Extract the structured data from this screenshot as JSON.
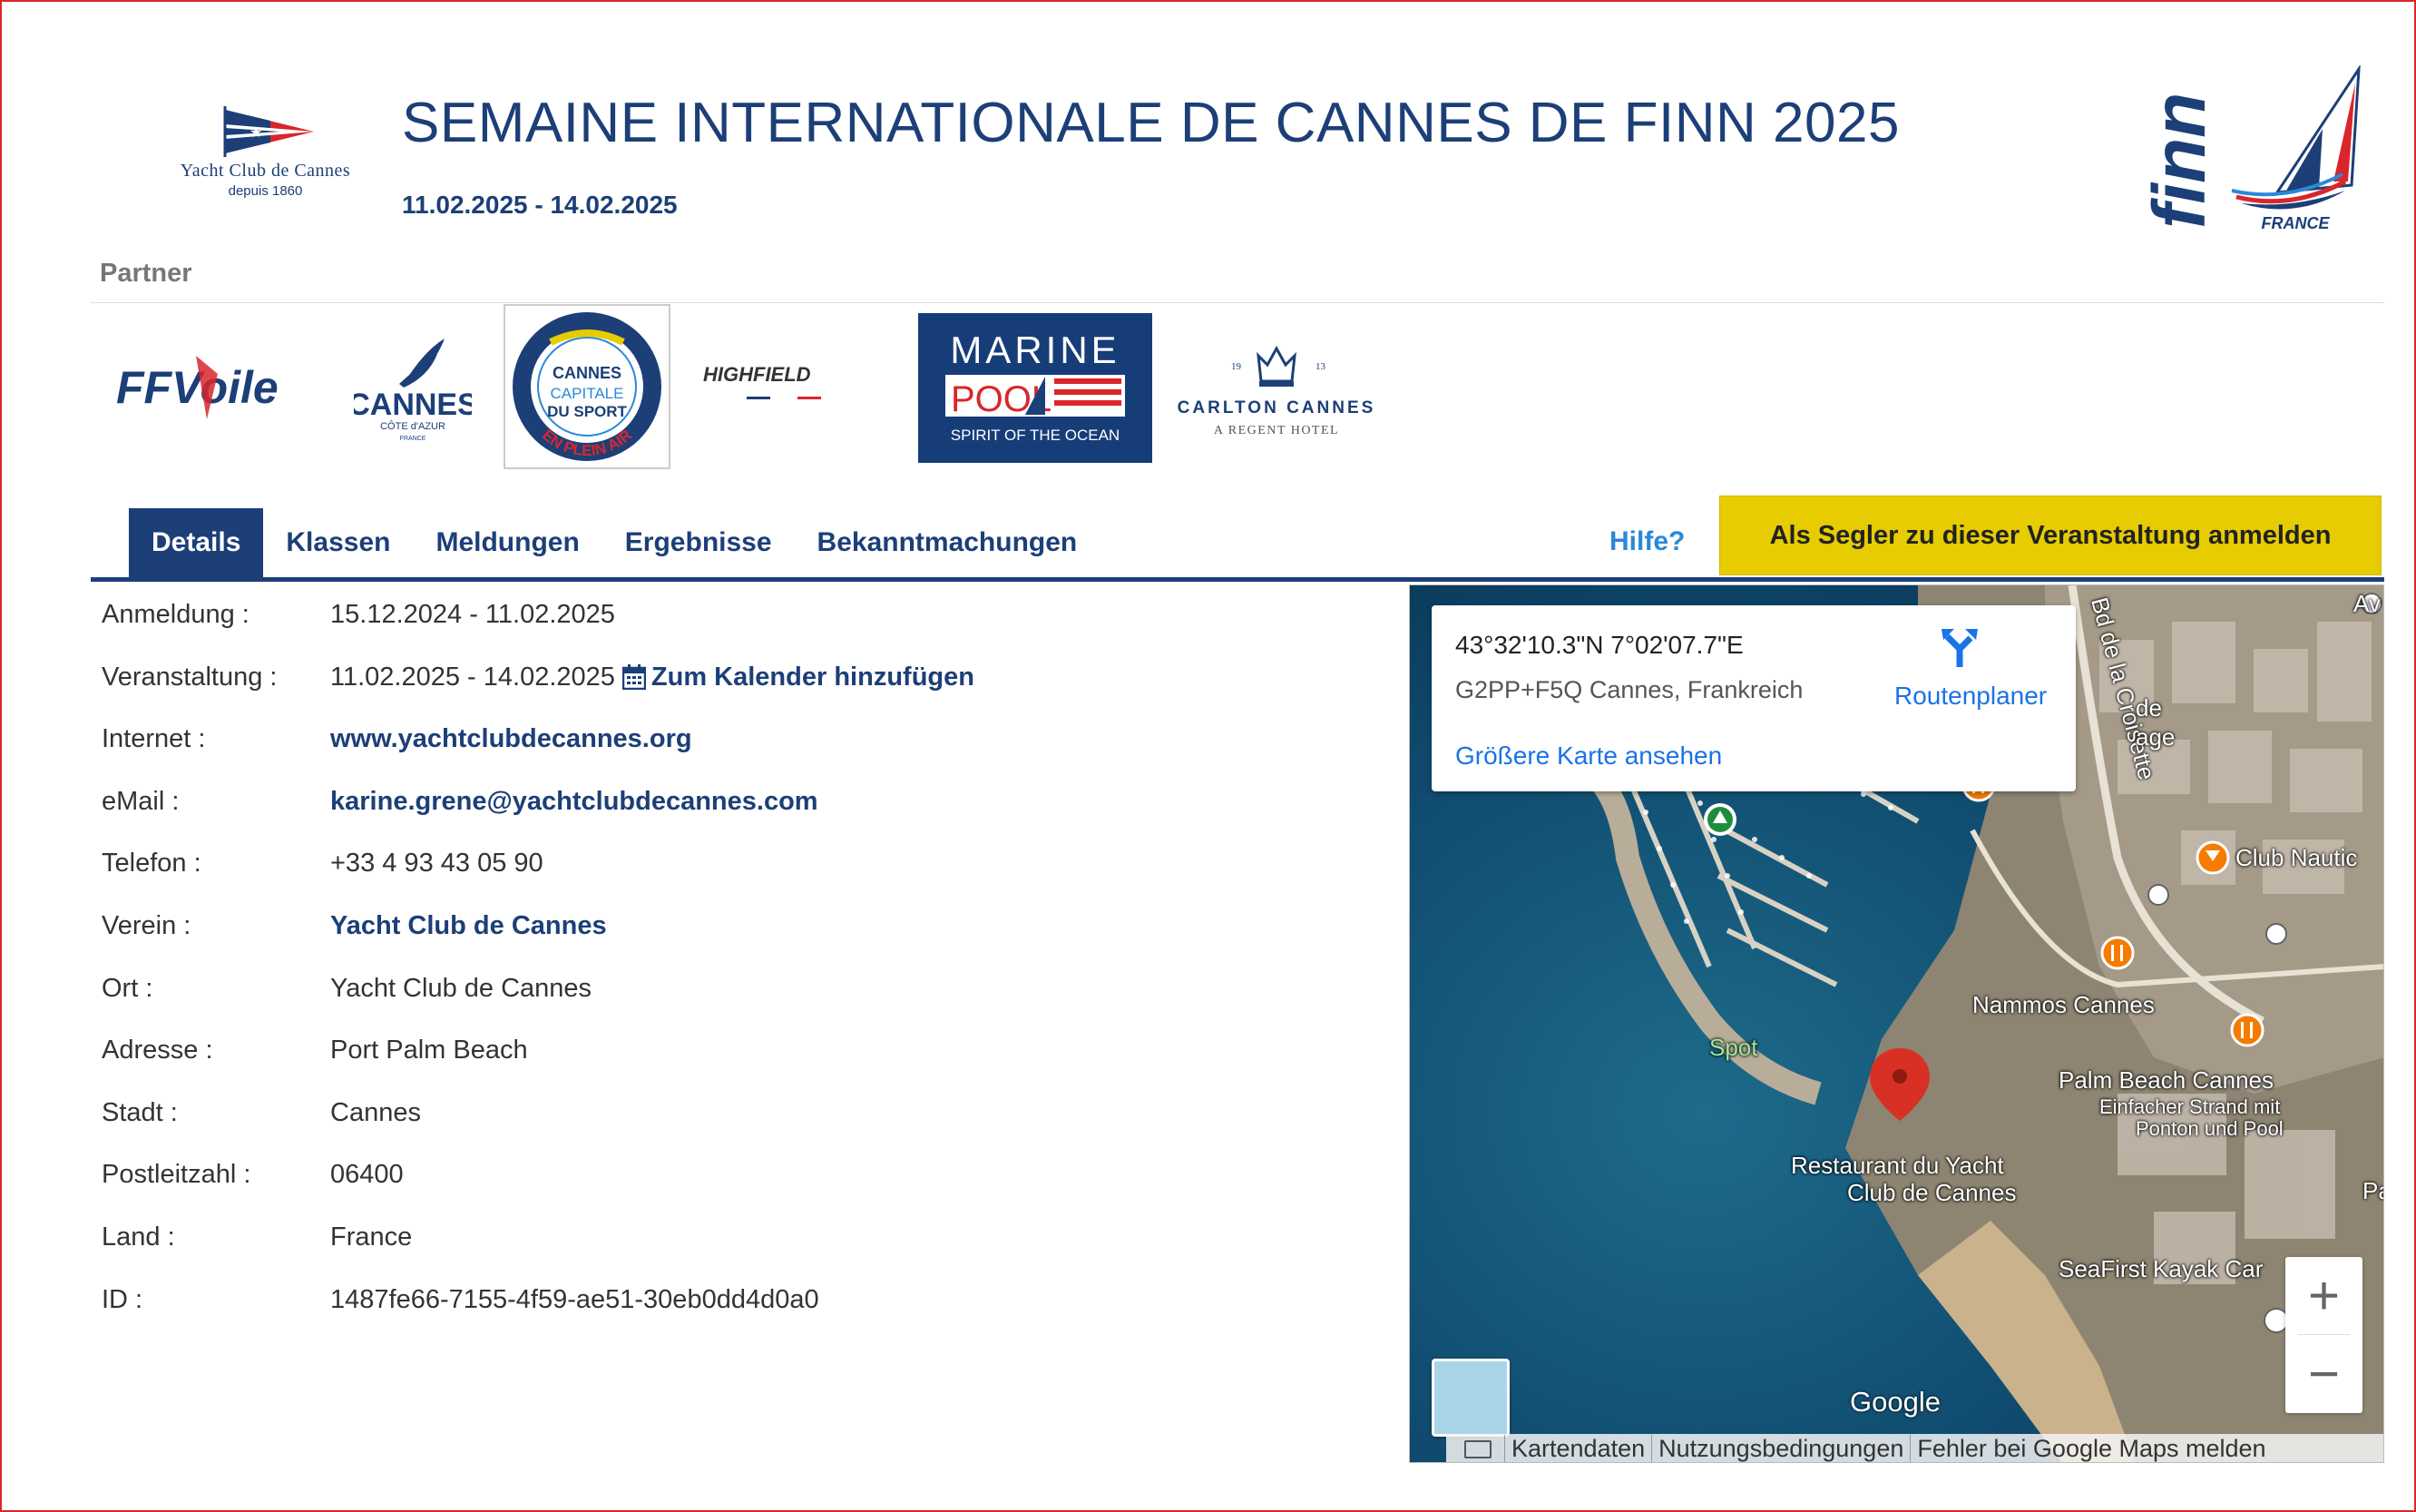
{
  "header": {
    "club_name": "Yacht Club de Cannes",
    "club_since": "depuis 1860",
    "title": "SEMAINE INTERNATIONALE DE CANNES DE FINN 2025",
    "dates": "11.02.2025 - 14.02.2025",
    "class_logo_word": "finn",
    "class_logo_country": "FRANCE"
  },
  "partners": {
    "label": "Partner",
    "logos": {
      "ffvoile": "FFVoile",
      "cannes": "CANNES",
      "cannes_sub": "CÔTE d'AZUR",
      "cannes_country": "FRANCE",
      "capitale_top": "CANNES",
      "capitale_mid1": "CAPITALE",
      "capitale_mid2": "DU SPORT",
      "capitale_arc": "EN PLEIN AIR",
      "highfield": "HIGHFIELD",
      "marine_top": "MARINE",
      "marine_mid": "POOL",
      "marine_bottom": "SPIRIT OF THE OCEAN",
      "carlton_year_left": "19",
      "carlton_year_right": "13",
      "carlton_name": "CARLTON CANNES",
      "carlton_sub": "A REGENT HOTEL"
    }
  },
  "tabs": [
    {
      "label": "Details",
      "active": true
    },
    {
      "label": "Klassen",
      "active": false
    },
    {
      "label": "Meldungen",
      "active": false
    },
    {
      "label": "Ergebnisse",
      "active": false
    },
    {
      "label": "Bekanntmachungen",
      "active": false
    }
  ],
  "help_label": "Hilfe?",
  "register_label": "Als Segler zu dieser Veranstaltung anmelden",
  "details": [
    {
      "label": "Anmeldung :",
      "value": "15.12.2024 - 11.02.2025",
      "link": false
    },
    {
      "label": "Veranstaltung :",
      "value": "11.02.2025 - 14.02.2025",
      "link": false,
      "calendar": "Zum Kalender hinzufügen"
    },
    {
      "label": "Internet :",
      "value": "www.yachtclubdecannes.org",
      "link": true
    },
    {
      "label": "eMail :",
      "value": "karine.grene@yachtclubdecannes.com",
      "link": true
    },
    {
      "label": "Telefon :",
      "value": "+33 4 93 43 05 90",
      "link": false
    },
    {
      "label": "Verein :",
      "value": "Yacht Club de Cannes",
      "link": true
    },
    {
      "label": "Ort :",
      "value": "Yacht Club de Cannes",
      "link": false
    },
    {
      "label": "Adresse :",
      "value": "Port Palm Beach",
      "link": false
    },
    {
      "label": "Stadt :",
      "value": "Cannes",
      "link": false
    },
    {
      "label": "Postleitzahl :",
      "value": "06400",
      "link": false
    },
    {
      "label": "Land :",
      "value": "France",
      "link": false
    },
    {
      "label": "ID :",
      "value": "1487fe66-7155-4f59-ae51-30eb0dd4d0a0",
      "link": false
    }
  ],
  "map": {
    "coords": "43°32'10.3\"N 7°02'07.7\"E",
    "plus_code": "G2PP+F5Q Cannes, Frankreich",
    "route_label": "Routenplaner",
    "bigger_map": "Größere Karte ansehen",
    "labels": {
      "croisette": "Bd de la Croisette",
      "club_nautic": "Club Nautic",
      "nammos": "Nammos Cannes",
      "palm_beach": "Palm Beach Cannes",
      "palm_beach_sub1": "Einfacher Strand mit",
      "palm_beach_sub2": "Ponton und Pool",
      "spot": "Spot",
      "restaurant1": "Restaurant du Yacht",
      "restaurant2": "Club de Cannes",
      "seafirst": "SeaFirst Kayak Car",
      "partial_de": "de",
      "partial_age": "age",
      "partial_av": "Av",
      "partial_pa": "Pa"
    },
    "zoom_in": "+",
    "zoom_out": "−",
    "google": "Google",
    "attrib": [
      "Kartendaten",
      "Nutzungsbedingungen",
      "Fehler bei Google Maps melden"
    ]
  },
  "colors": {
    "navy": "#1c3f78",
    "accent_yellow": "#e6cc00",
    "link_blue": "#1a73e8",
    "frame_red": "#d9262b"
  }
}
